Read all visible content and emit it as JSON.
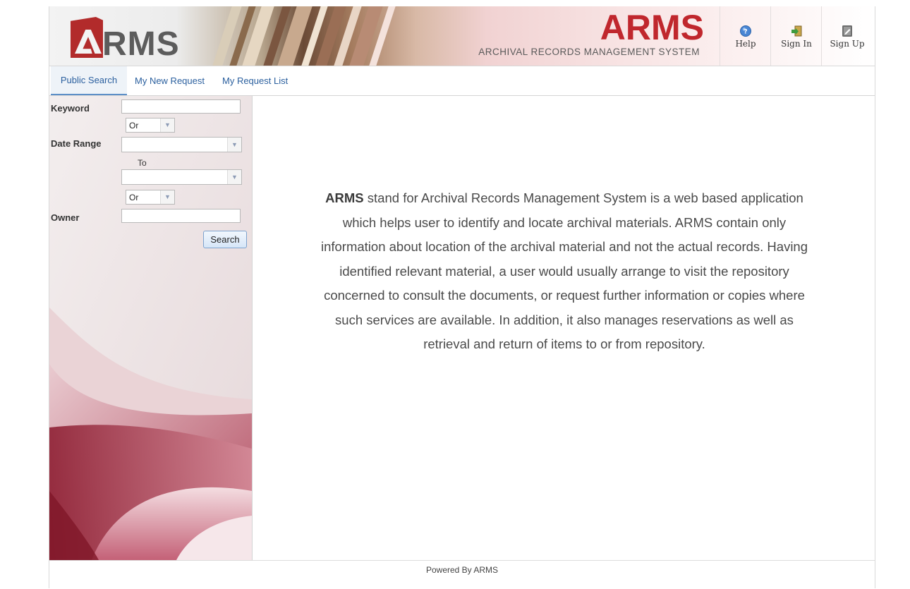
{
  "header": {
    "logo_text": "RMS",
    "title": "ARMS",
    "subtitle": "ARCHIVAL RECORDS MANAGEMENT SYSTEM",
    "buttons": [
      {
        "label": "Help",
        "icon": "help-icon"
      },
      {
        "label": "Sign In",
        "icon": "sign-in-icon"
      },
      {
        "label": "Sign Up",
        "icon": "sign-up-icon"
      }
    ]
  },
  "tabs": [
    {
      "label": "Public Search",
      "active": true
    },
    {
      "label": "My New Request",
      "active": false
    },
    {
      "label": "My Request List",
      "active": false
    }
  ],
  "search_form": {
    "keyword_label": "Keyword",
    "keyword_value": "",
    "operator1": "Or",
    "date_range_label": "Date Range",
    "date_from": "",
    "to_label": "To",
    "date_to": "",
    "operator2": "Or",
    "owner_label": "Owner",
    "owner_value": "",
    "search_button": "Search"
  },
  "intro": {
    "bold": "ARMS",
    "text": " stand for Archival Records Management System is a web based application which helps user to identify and locate archival materials. ARMS contain only information about location of the archival material and not the actual records. Having identified relevant material, a user would usually arrange to visit the repository concerned to consult the documents, or request further information or copies where such services are available. In addition, it also manages reservations as well as retrieval and return of items to or from repository."
  },
  "footer": {
    "text": "Powered By ARMS"
  },
  "colors": {
    "brand_red": "#c0272d",
    "link_blue": "#2a5f9e"
  }
}
